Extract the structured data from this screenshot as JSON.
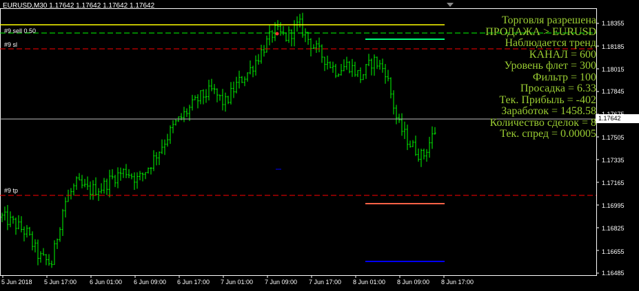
{
  "header": {
    "symbol_text": "EURUSD,M30  1.17642 1.17642 1.17642 1.17642"
  },
  "orders": {
    "sell_label": "#9 sell 0.50",
    "sl_label": "#9 sl",
    "tp_label": "#9 tp"
  },
  "info_panel": {
    "lines": [
      "Торговля разрешена",
      "ПРОДАЖА > EURUSD",
      "Наблюдается тренд",
      "КАНАЛ = 600",
      "Уровень флет = 300",
      "Фильтр  = 100",
      "Просадка  = 6.33",
      "Тек. Прибыль = -402",
      "Заработок  = 1458.58",
      "Количество сделок = 8",
      "Тек. спред =  0.00005"
    ],
    "color": "#9acd32"
  },
  "price_axis": {
    "ticks": [
      "1.18355",
      "1.18185",
      "1.18015",
      "1.17845",
      "1.17675",
      "1.17505",
      "1.17335",
      "1.17165",
      "1.16995",
      "1.16825",
      "1.16655",
      "1.16485"
    ],
    "current_price": "1.17642"
  },
  "time_axis": {
    "ticks": [
      "5 Jun 2018",
      "5 Jun 17:00",
      "6 Jun 01:00",
      "6 Jun 09:00",
      "6 Jun 17:00",
      "7 Jun 01:00",
      "7 Jun 09:00",
      "7 Jun 17:00",
      "8 Jun 01:00",
      "8 Jun 09:00",
      "8 Jun 17:00"
    ]
  },
  "colors": {
    "candles": "#00ff00",
    "sell_line": "#ffff00",
    "sl_line": "#ff0000",
    "tp_line": "#ff0000",
    "level_green": "#00ff7f",
    "level_orange": "#ff6347",
    "level_blue": "#0000ff",
    "grid": "#ffffff"
  },
  "chart_data": {
    "type": "line",
    "title": "EURUSD,M30",
    "x": [
      "5 Jun 2018",
      "5 Jun 17:00",
      "6 Jun 01:00",
      "6 Jun 09:00",
      "6 Jun 17:00",
      "7 Jun 01:00",
      "7 Jun 09:00",
      "7 Jun 17:00",
      "8 Jun 01:00",
      "8 Jun 09:00"
    ],
    "series": [
      {
        "name": "EURUSD",
        "values": [
          1.1695,
          1.1715,
          1.1725,
          1.1745,
          1.1775,
          1.179,
          1.1825,
          1.1815,
          1.18,
          1.1765
        ]
      }
    ],
    "ylim": [
      1.16485,
      1.18355
    ],
    "levels": {
      "sell": 1.1836,
      "sl": 1.1823,
      "tp": 1.1708,
      "current": 1.17642
    }
  }
}
